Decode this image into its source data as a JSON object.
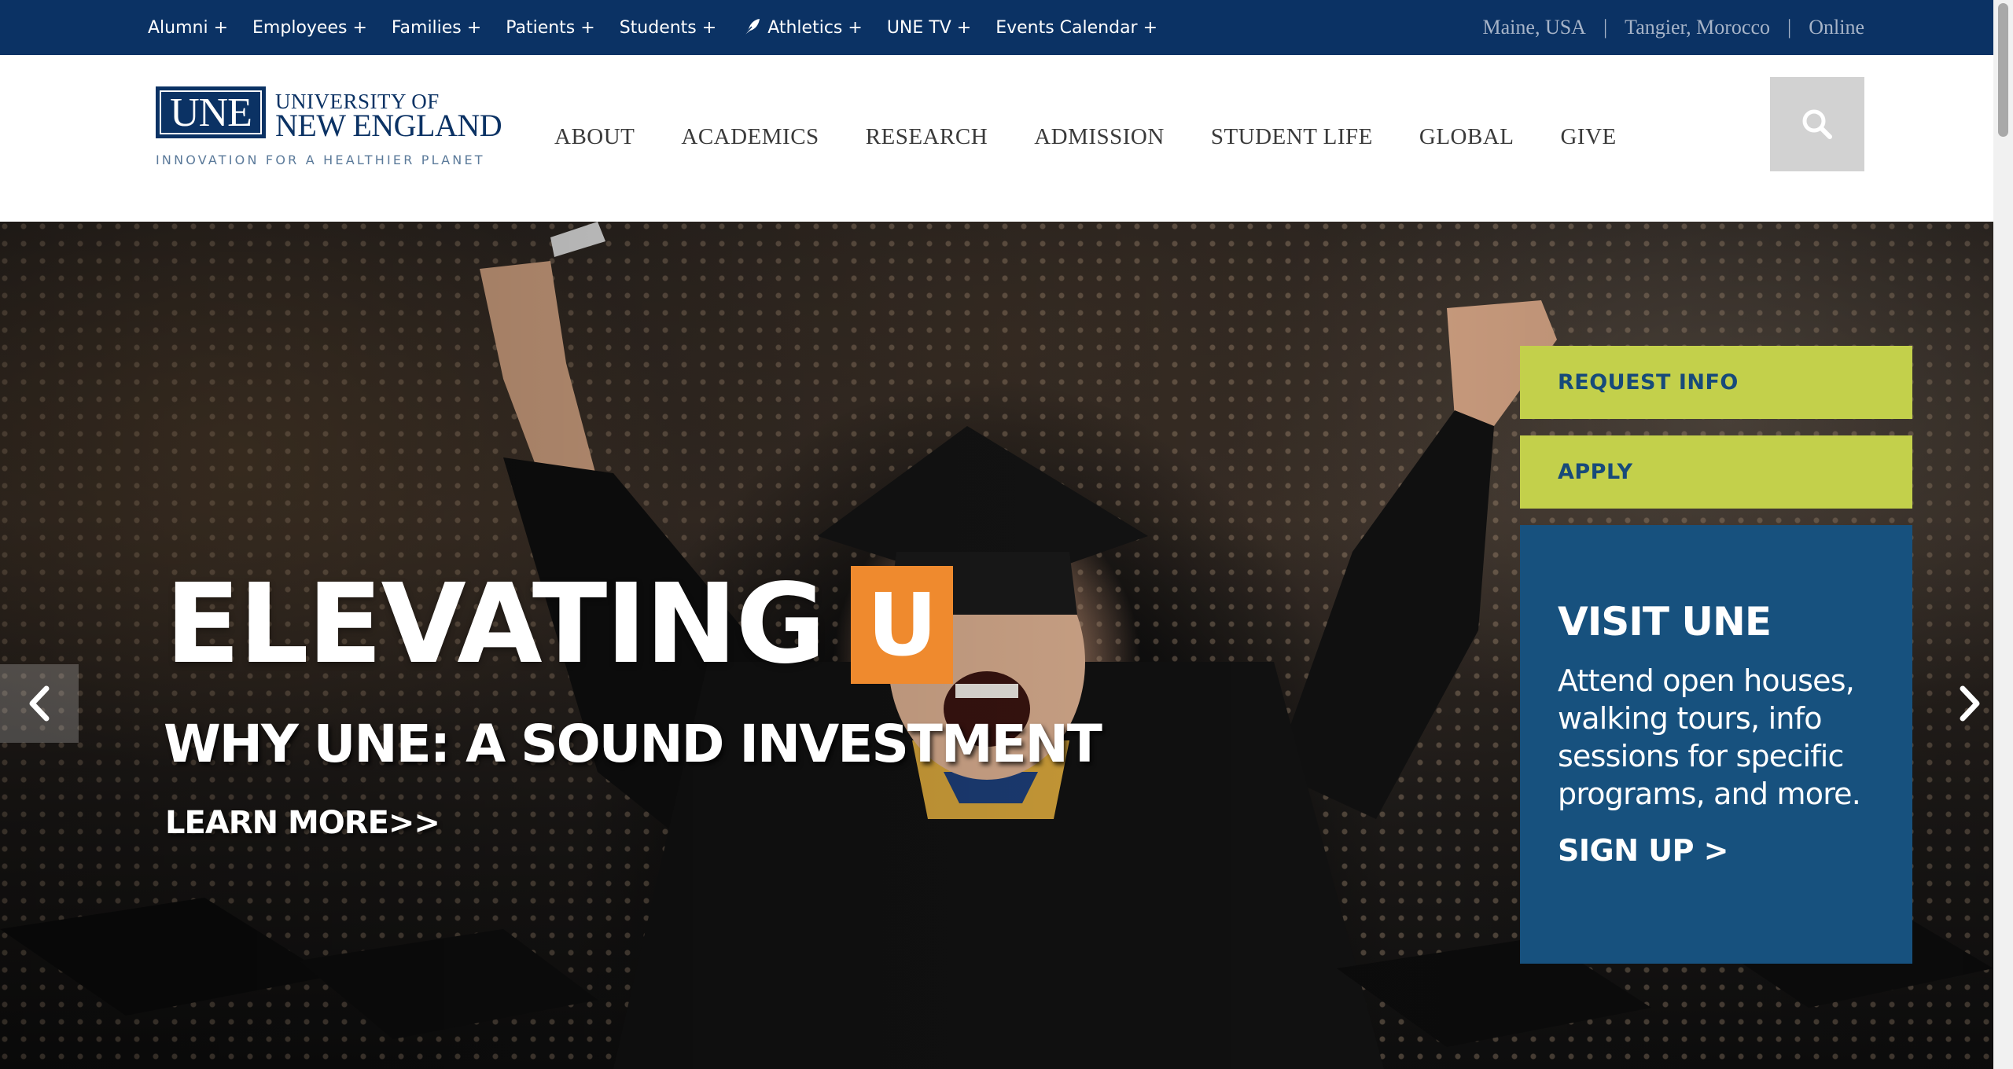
{
  "utility_nav": {
    "items": [
      {
        "label": "Alumni +"
      },
      {
        "label": "Employees +"
      },
      {
        "label": "Families +"
      },
      {
        "label": "Patients +"
      },
      {
        "label": "Students +"
      },
      {
        "label": "Athletics +",
        "icon": "feather-icon"
      },
      {
        "label": "UNE TV +"
      },
      {
        "label": "Events Calendar +"
      }
    ],
    "campuses": [
      {
        "label": "Maine, USA"
      },
      {
        "label": "Tangier, Morocco"
      },
      {
        "label": "Online"
      }
    ],
    "separator": "|"
  },
  "logo": {
    "abbr": "UNE",
    "line1": "UNIVERSITY OF",
    "line2": "NEW ENGLAND",
    "tagline": "INNOVATION FOR A HEALTHIER PLANET"
  },
  "main_nav": {
    "items": [
      {
        "label": "ABOUT"
      },
      {
        "label": "ACADEMICS"
      },
      {
        "label": "RESEARCH"
      },
      {
        "label": "ADMISSION"
      },
      {
        "label": "STUDENT LIFE"
      },
      {
        "label": "GLOBAL"
      },
      {
        "label": "GIVE"
      }
    ],
    "search_icon": "search-icon"
  },
  "hero": {
    "headline": "ELEVATING",
    "headline_highlight": "U",
    "subtitle": "WHY UNE: A SOUND INVESTMENT",
    "cta": "LEARN MORE>>",
    "prev_icon": "chevron-left-icon",
    "next_icon": "chevron-right-icon"
  },
  "actions": {
    "request_info": "REQUEST INFO",
    "apply": "APPLY"
  },
  "visit_card": {
    "title": "VISIT UNE",
    "body": "Attend open houses, walking tours, info sessions for specific programs, and more.",
    "cta": "SIGN UP >"
  },
  "colors": {
    "brand_navy": "#0b3264",
    "accent_green": "#c3d04b",
    "visit_blue": "#17517e",
    "highlight_orange": "#ef8a2e"
  }
}
